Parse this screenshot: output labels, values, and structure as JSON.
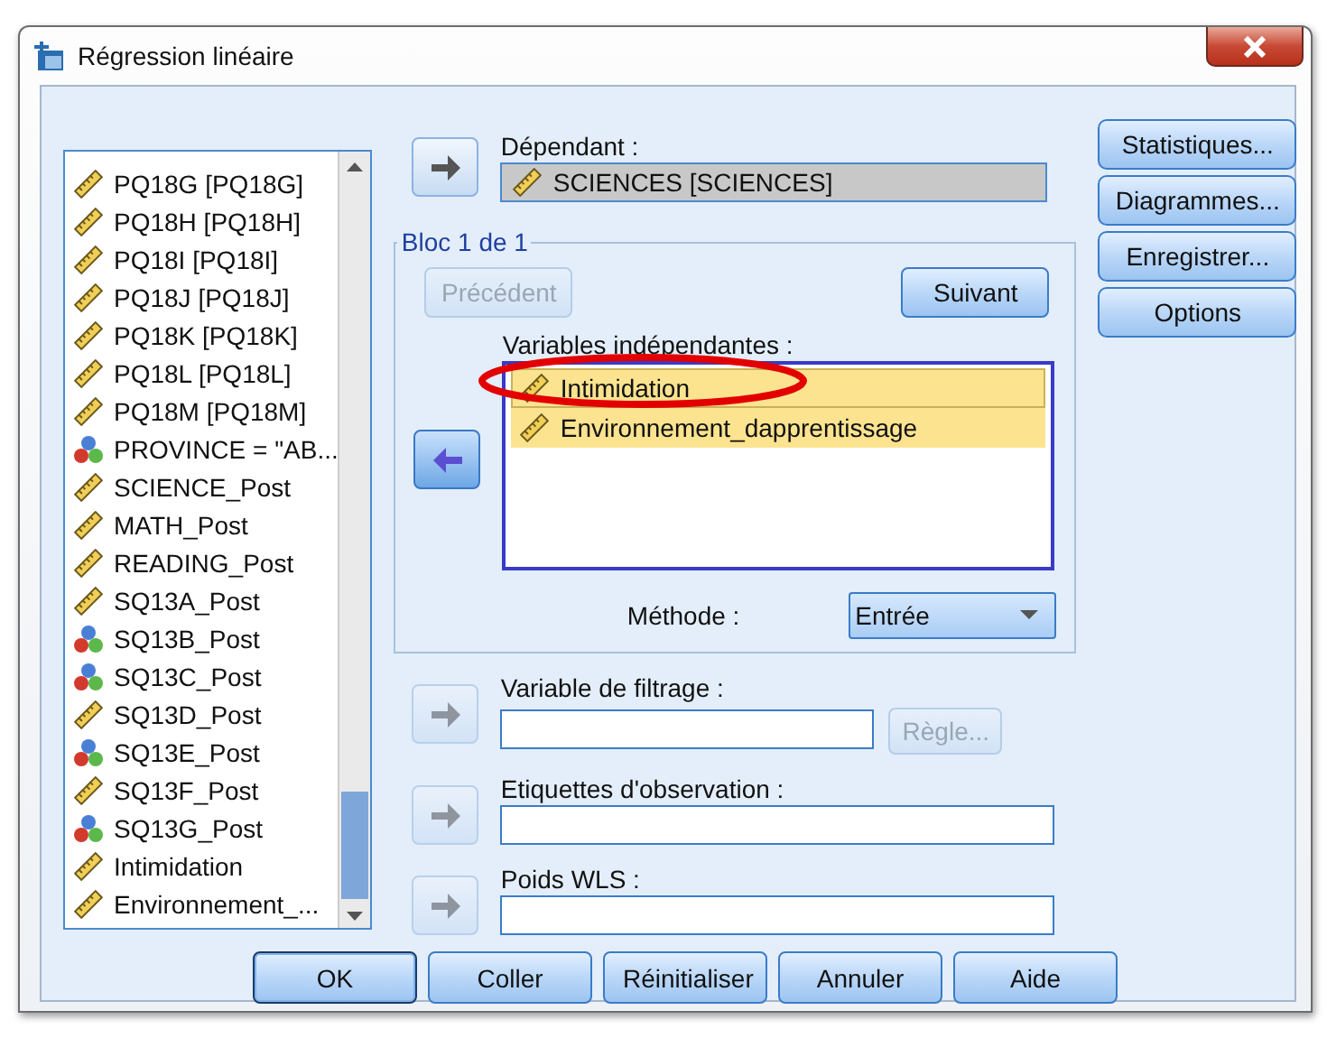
{
  "window": {
    "title": "Régression linéaire"
  },
  "variables": [
    {
      "name": "PQ18G [PQ18G]",
      "kind": "scale"
    },
    {
      "name": "PQ18H [PQ18H]",
      "kind": "scale"
    },
    {
      "name": "PQ18I [PQ18I]",
      "kind": "scale"
    },
    {
      "name": "PQ18J [PQ18J]",
      "kind": "scale"
    },
    {
      "name": "PQ18K [PQ18K]",
      "kind": "scale"
    },
    {
      "name": "PQ18L [PQ18L]",
      "kind": "scale"
    },
    {
      "name": "PQ18M [PQ18M]",
      "kind": "scale"
    },
    {
      "name": "PROVINCE = \"AB...",
      "kind": "nominal"
    },
    {
      "name": "SCIENCE_Post",
      "kind": "scale"
    },
    {
      "name": "MATH_Post",
      "kind": "scale"
    },
    {
      "name": "READING_Post",
      "kind": "scale"
    },
    {
      "name": "SQ13A_Post",
      "kind": "scale"
    },
    {
      "name": "SQ13B_Post",
      "kind": "nominal"
    },
    {
      "name": "SQ13C_Post",
      "kind": "nominal"
    },
    {
      "name": "SQ13D_Post",
      "kind": "scale"
    },
    {
      "name": "SQ13E_Post",
      "kind": "nominal"
    },
    {
      "name": "SQ13F_Post",
      "kind": "scale"
    },
    {
      "name": "SQ13G_Post",
      "kind": "nominal"
    },
    {
      "name": "Intimidation",
      "kind": "scale"
    },
    {
      "name": "Environnement_...",
      "kind": "scale"
    }
  ],
  "dependent": {
    "label": "Dépendant :",
    "value": "SCIENCES [SCIENCES]",
    "kind": "scale",
    "arrow": {
      "kind": "right",
      "disabled": false
    }
  },
  "block": {
    "title": "Bloc 1 de 1",
    "previous": {
      "label": "Précédent",
      "disabled": true
    },
    "next": {
      "label": "Suivant",
      "disabled": false
    },
    "independents_label": "Variables indépendantes :",
    "arrow": {
      "kind": "left",
      "disabled": false
    },
    "independents": [
      {
        "name": "Intimidation",
        "kind": "scale",
        "selected": true
      },
      {
        "name": "Environnement_dapprentissage",
        "kind": "scale",
        "selected": true
      }
    ],
    "method_label": "Méthode :",
    "method": "Entrée"
  },
  "filter": {
    "label": "Variable de filtrage :",
    "rule": {
      "label": "Règle...",
      "disabled": true
    },
    "arrow": {
      "kind": "right",
      "disabled": true
    }
  },
  "case_labels": {
    "label": "Etiquettes d'observation :",
    "arrow": {
      "kind": "right",
      "disabled": true
    }
  },
  "wls": {
    "label": "Poids WLS :",
    "arrow": {
      "kind": "right",
      "disabled": true
    }
  },
  "side_buttons": [
    "Statistiques...",
    "Diagrammes...",
    "Enregistrer...",
    "Options"
  ],
  "buttons": [
    {
      "label": "OK",
      "default": true
    },
    {
      "label": "Coller",
      "default": false
    },
    {
      "label": "Réinitialiser",
      "default": false
    },
    {
      "label": "Annuler",
      "default": false
    },
    {
      "label": "Aide",
      "default": false
    }
  ],
  "annotation": {
    "kind": "ellipse"
  }
}
